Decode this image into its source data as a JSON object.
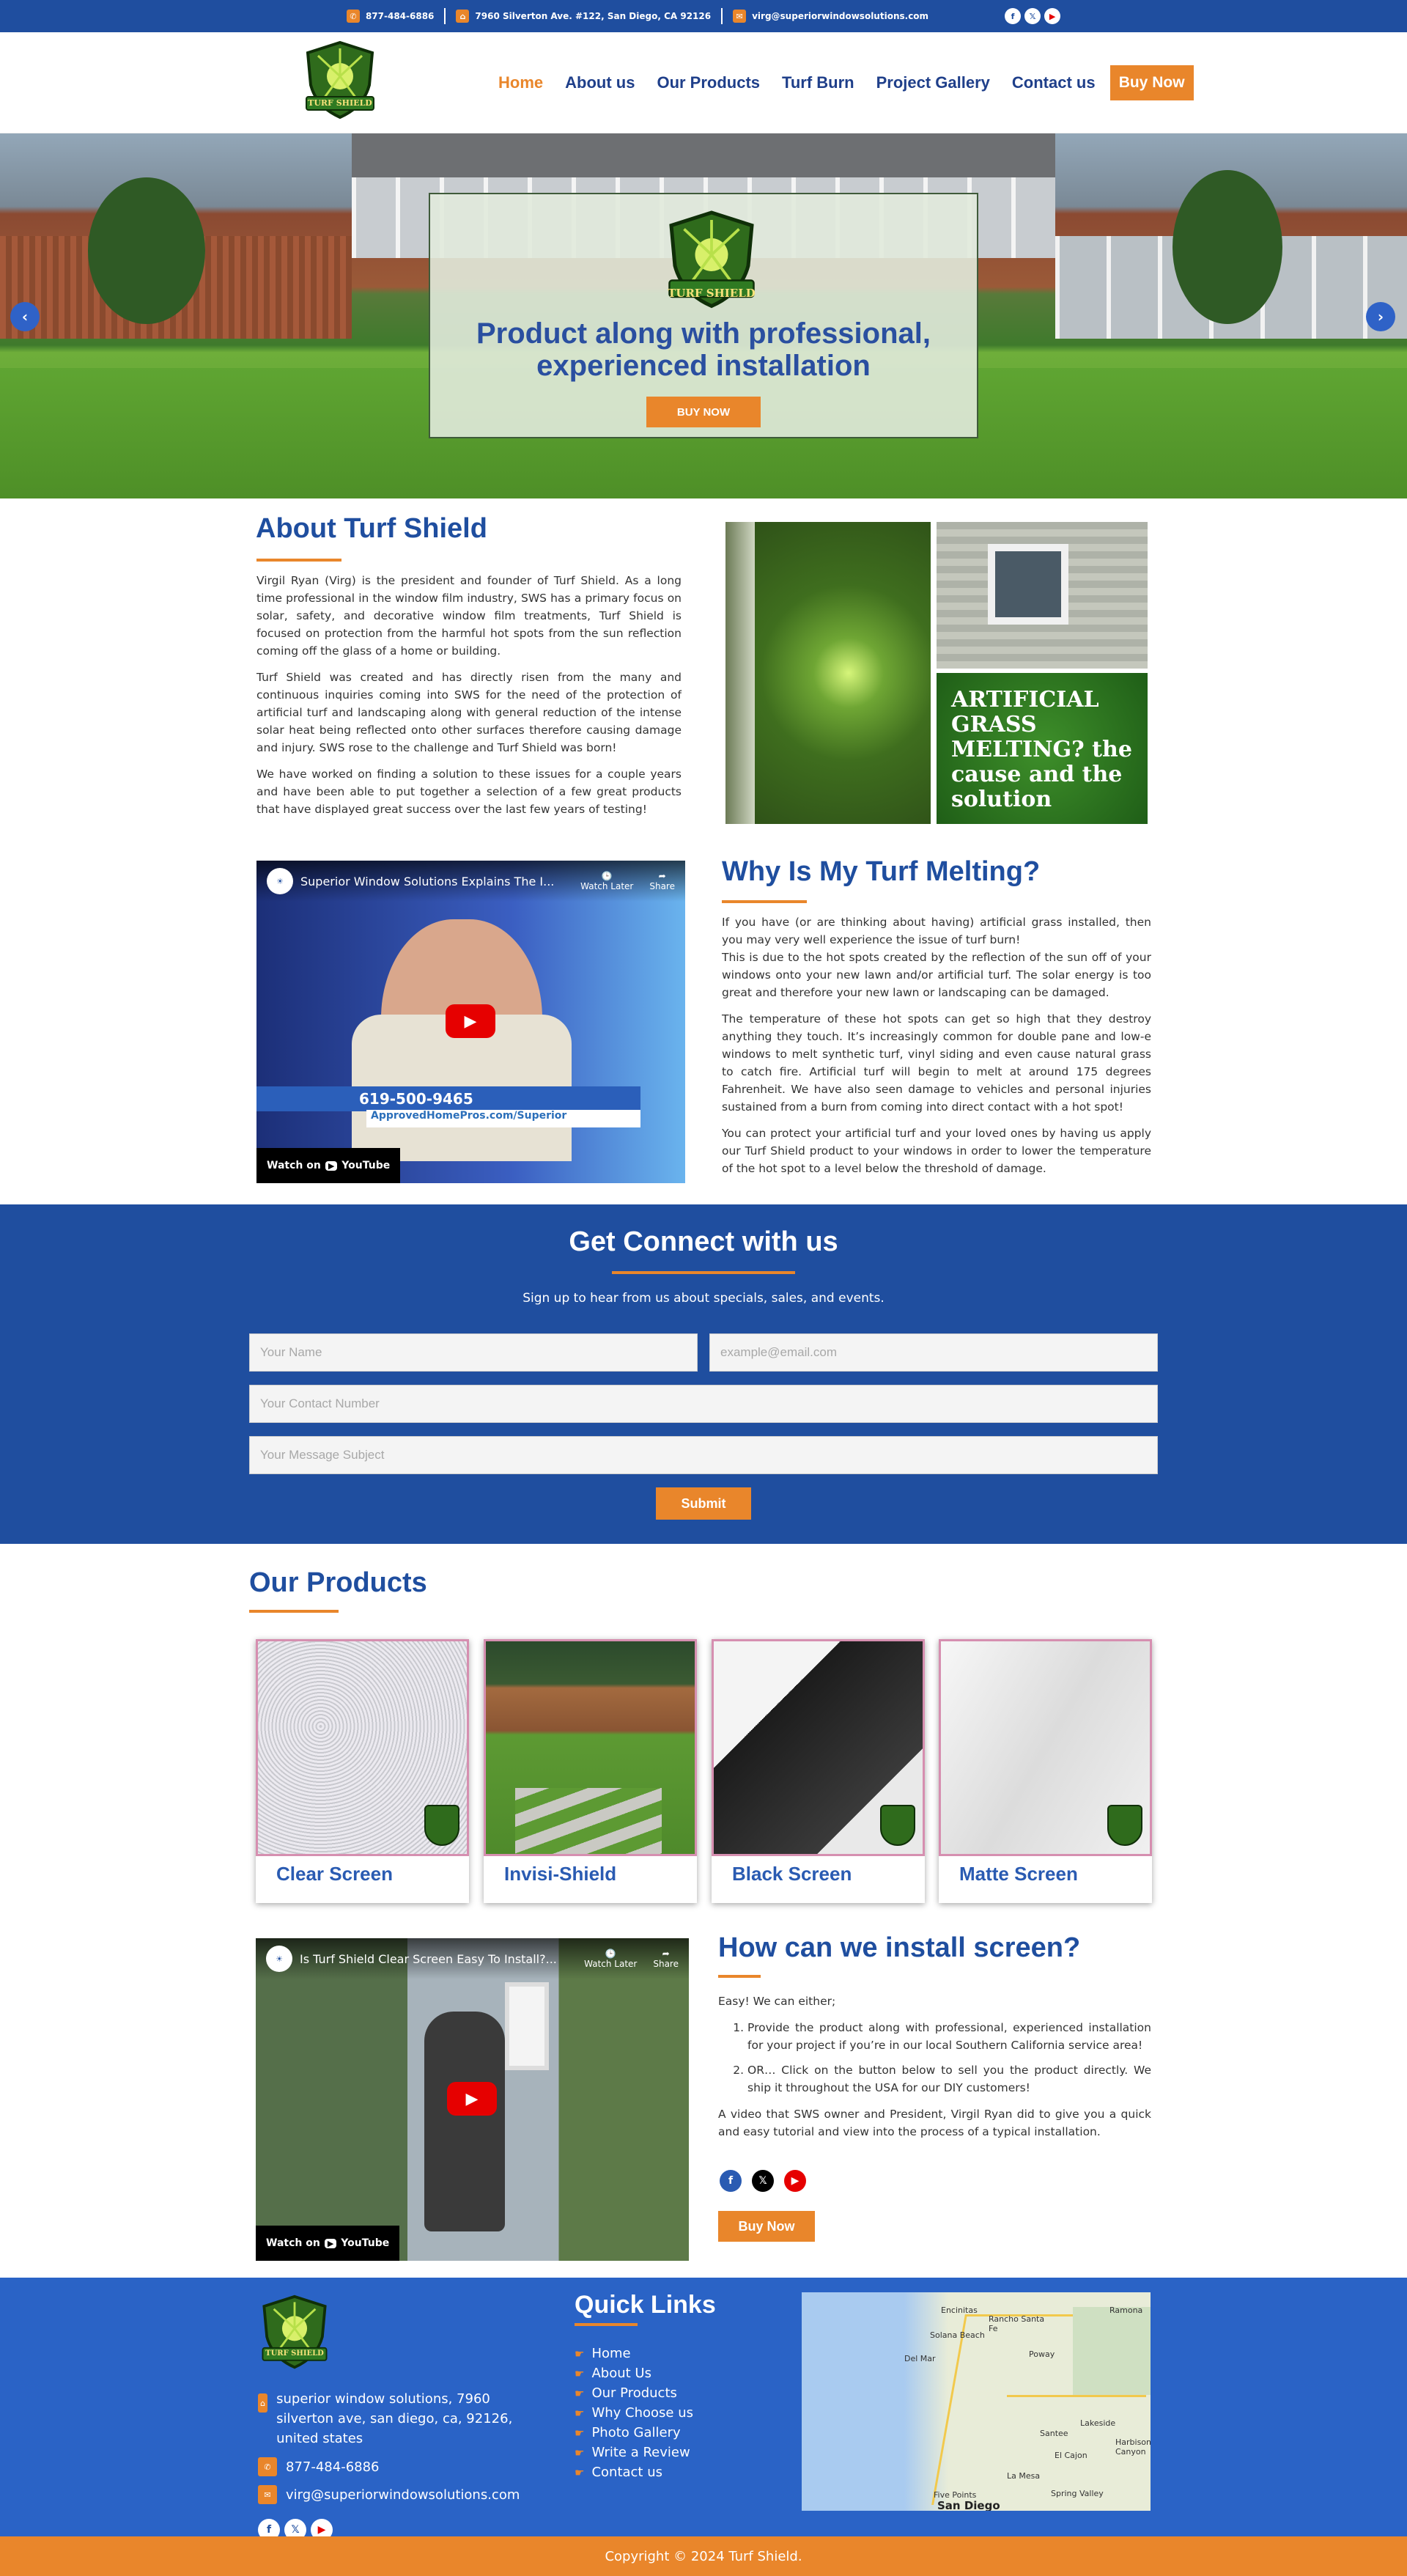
{
  "colors": {
    "primary": "#1f4e9f",
    "accent": "#e9862b",
    "footer": "#2a63c6"
  },
  "topbar": {
    "phone": "877-484-6886",
    "address": "7960 Silverton Ave. #122, San Diego, CA 92126",
    "email": "virg@superiorwindowsolutions.com",
    "social_icons": [
      "facebook-icon",
      "x-icon",
      "youtube-icon"
    ]
  },
  "header": {
    "logo_text": "TURF SHIELD",
    "nav": [
      "Home",
      "About us",
      "Our Products",
      "Turf Burn",
      "Project Gallery",
      "Contact us"
    ],
    "buy_now": "Buy Now"
  },
  "hero": {
    "logo_text": "TURF SHIELD",
    "title": "Product along with professional, experienced installation",
    "button": "BUY NOW",
    "prev_icon": "chevron-left-icon",
    "next_icon": "chevron-right-icon"
  },
  "about": {
    "title": "About Turf Shield",
    "p1": "Virgil Ryan (Virg) is the president and founder of Turf Shield.  As a long time professional in the window film industry, SWS has a primary focus on solar, safety, and decorative window film treatments, Turf Shield is focused on protection from the harmful hot spots from the sun reflection coming off the glass of a home or building.",
    "p2": "Turf Shield was created and has directly risen from the many and continuous inquiries coming into SWS for the need of the protection of artificial turf and landscaping along with general reduction of the intense solar heat being reflected onto other surfaces therefore causing damage and injury. SWS rose to the challenge and Turf Shield was born!",
    "p3": "We have worked on finding a solution to these issues for a couple years and have been able to put together a selection of a few great products that have displayed great success over the last few years of testing!",
    "collage_text": "ARTIFICIAL GRASS MELTING? the cause and the solution"
  },
  "melting": {
    "title": "Why Is My Turf Melting?",
    "p1": "If you have (or are thinking about having) artificial grass installed, then you may very well experience the issue of turf burn!",
    "p1b": "This is due to the hot spots created by the reflection of the sun off of your windows onto your new lawn and/or artificial turf.  The solar energy is too great and therefore your new lawn or landscaping can be damaged.",
    "p2": "The temperature of these hot spots can get so high that they destroy anything they touch. It’s increasingly common for double pane and low-e windows to melt synthetic turf, vinyl siding and even cause natural grass to catch fire. Artificial turf will begin to melt at around 175 degrees Fahrenheit. We have also seen damage to vehicles and personal injuries sustained from a burn from coming into direct contact with a hot spot!",
    "p3": "You can protect your artificial turf and your loved ones by having us apply our Turf Shield product to your windows in order to lower the temperature of the hot spot to a level below the threshold of damage.",
    "video": {
      "title": "Superior Window Solutions Explains The I...",
      "watch_later": "Watch Later",
      "share": "Share",
      "watch_on": "Watch on",
      "youtube": "YouTube",
      "phone_overlay": "619-500-9465",
      "url_overlay": "ApprovedHomePros.com/Superior"
    }
  },
  "connect": {
    "title": "Get Connect with us",
    "subtitle": "Sign up to hear from us about specials, sales, and events.",
    "name_placeholder": "Your Name",
    "email_placeholder": "example@email.com",
    "contact_placeholder": "Your Contact Number",
    "subject_placeholder": "Your Message Subject",
    "submit": "Submit"
  },
  "products": {
    "title": "Our Products",
    "items": [
      "Clear Screen",
      "Invisi-Shield",
      "Black Screen",
      "Matte Screen"
    ]
  },
  "install": {
    "title": "How can we install screen?",
    "intro": "Easy! We can either;",
    "li1": "Provide the product along with professional, experienced installation for your project if you’re in our local Southern California service area!",
    "li2": "OR… Click on the button below to sell you the product directly. We ship it throughout the USA for our DIY customers!",
    "outro": "A video that SWS owner and President, Virgil Ryan did to give you a quick and easy tutorial and view into the process of a typical installation.",
    "button": "Buy Now",
    "video": {
      "title": "Is Turf Shield Clear Screen Easy To Install?...",
      "watch_later": "Watch Later",
      "share": "Share",
      "watch_on": "Watch on",
      "youtube": "YouTube"
    }
  },
  "footer": {
    "logo_text": "TURF SHIELD",
    "address": "superior window solutions, 7960 silverton ave, san diego, ca, 92126, united states",
    "phone": "877-484-6886",
    "email": "virg@superiorwindowsolutions.com",
    "quick_links_title": "Quick Links",
    "links": [
      "Home",
      "About Us",
      "Our Products",
      "Why Choose us",
      "Photo Gallery",
      "Write a Review",
      "Contact us"
    ],
    "map_labels": [
      "Encinitas",
      "Rancho Santa Fe",
      "Ramona",
      "Solana Beach",
      "Del Mar",
      "Poway",
      "Lakeside",
      "Santee",
      "El Cajon",
      "La Mesa",
      "Spring Valley",
      "Harbison Canyon",
      "Five Points",
      "San Diego"
    ],
    "copyright": "Copyright © 2024 Turf Shield."
  }
}
